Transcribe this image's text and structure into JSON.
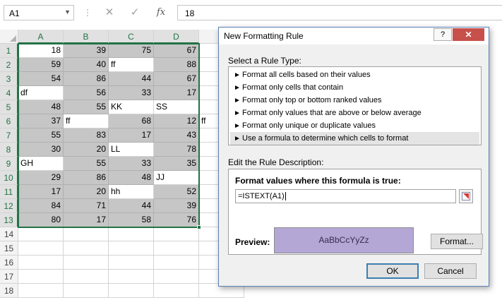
{
  "formula_bar": {
    "name_box": "A1",
    "cancel_icon": "✕",
    "enter_icon": "✓",
    "fx_label": "fx",
    "value": "18"
  },
  "grid": {
    "columns": [
      "A",
      "B",
      "C",
      "D"
    ],
    "rows": [
      "1",
      "2",
      "3",
      "4",
      "5",
      "6",
      "7",
      "8",
      "9",
      "10",
      "11",
      "12",
      "13",
      "14",
      "15",
      "16",
      "17",
      "18"
    ],
    "cells": [
      [
        "18",
        "39",
        "75",
        "67"
      ],
      [
        "59",
        "40",
        "ff",
        "88"
      ],
      [
        "54",
        "86",
        "44",
        "67"
      ],
      [
        "df",
        "56",
        "33",
        "17"
      ],
      [
        "48",
        "55",
        "KK",
        "SS"
      ],
      [
        "37",
        "ff",
        "68",
        "12"
      ],
      [
        "55",
        "83",
        "17",
        "43"
      ],
      [
        "30",
        "20",
        "LL",
        "78"
      ],
      [
        "GH",
        "55",
        "33",
        "35"
      ],
      [
        "29",
        "86",
        "48",
        "JJ"
      ],
      [
        "17",
        "20",
        "hh",
        "52"
      ],
      [
        "84",
        "71",
        "44",
        "39"
      ],
      [
        "80",
        "17",
        "58",
        "76"
      ]
    ],
    "overflow_text": [
      {
        "row": 5,
        "text": "ff"
      }
    ]
  },
  "dialog": {
    "title": "New Formatting Rule",
    "help_label": "?",
    "close_label": "✕",
    "rule_type_label": "Select a Rule Type:",
    "rule_types": [
      "Format all cells based on their values",
      "Format only cells that contain",
      "Format only top or bottom ranked values",
      "Format only values that are above or below average",
      "Format only unique or duplicate values",
      "Use a formula to determine which cells to format"
    ],
    "selected_rule_index": 5,
    "edit_label": "Edit the Rule Description:",
    "formula_label": "Format values where this formula is true:",
    "formula_value": "=ISTEXT(A1)",
    "preview_label": "Preview:",
    "preview_text": "AaBbCcYyZz",
    "format_button": "Format...",
    "ok_button": "OK",
    "cancel_button": "Cancel",
    "colors": {
      "preview_fill": "#b4a7d6",
      "selection_accent": "#217346",
      "shaded_cell": "#c6c6c6",
      "close_button": "#c7504b"
    }
  }
}
